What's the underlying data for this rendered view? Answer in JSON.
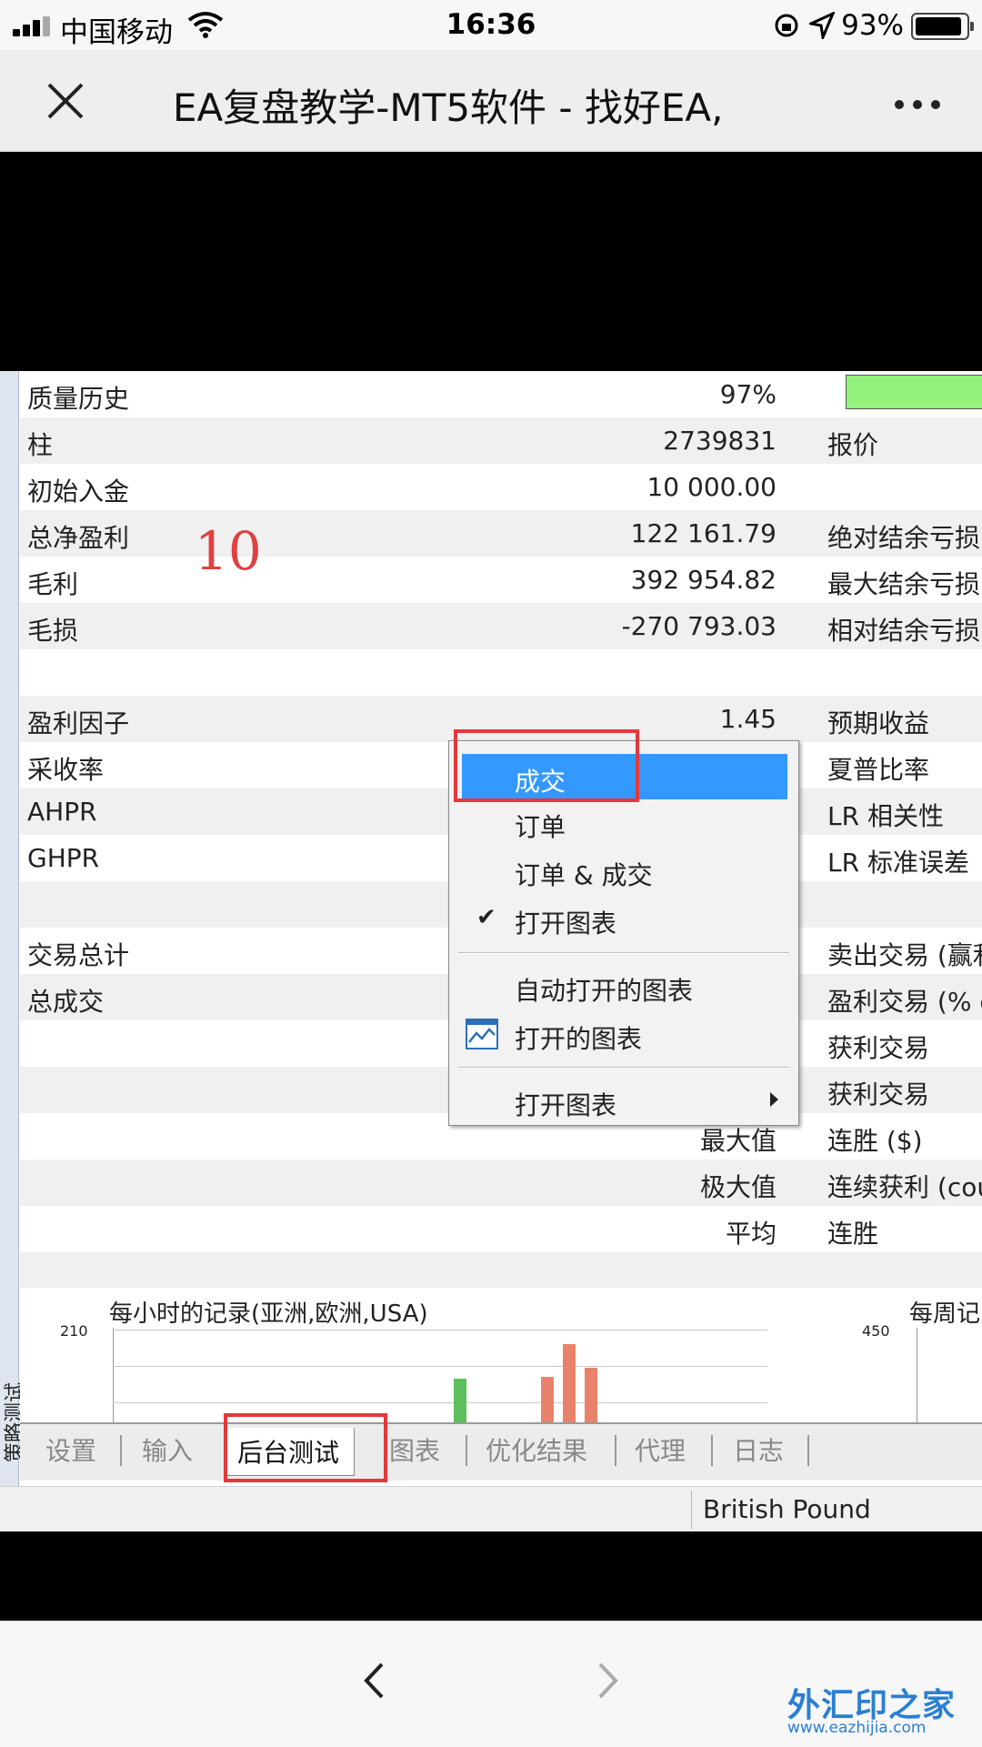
{
  "status_bar": {
    "carrier": "中国移动",
    "time": "16:36",
    "battery": "93%"
  },
  "nav": {
    "title": "EA复盘教学-MT5软件 - 找好EA,"
  },
  "side_label": "策略测试",
  "rows": [
    {
      "label": "质量历史",
      "value": "97%",
      "right": ""
    },
    {
      "label": "柱",
      "value": "2739831",
      "right": "报价"
    },
    {
      "label": "初始入金",
      "value": "10 000.00",
      "right": ""
    },
    {
      "label": "总净盈利",
      "value": "122 161.79",
      "right": "绝对结余亏损"
    },
    {
      "label": "毛利",
      "value": "392 954.82",
      "right": "最大结余亏损"
    },
    {
      "label": "毛损",
      "value": "-270 793.03",
      "right": "相对结余亏损"
    },
    {
      "label": "",
      "value": "",
      "right": ""
    },
    {
      "label": "盈利因子",
      "value": "1.45",
      "right": "预期收益"
    },
    {
      "label": "采收率",
      "value": "",
      "right": "夏普比率"
    },
    {
      "label": "AHPR",
      "value": "",
      "right": "LR 相关性"
    },
    {
      "label": "GHPR",
      "value": "",
      "right": "LR 标准误差"
    },
    {
      "label": "",
      "value": "",
      "right": ""
    },
    {
      "label": "交易总计",
      "value": "",
      "right": "卖出交易 (赢利"
    },
    {
      "label": "总成交",
      "value": "",
      "right": "盈利交易 (% of"
    },
    {
      "label": "",
      "value": "",
      "right": "获利交易"
    },
    {
      "label": "",
      "value": "",
      "right": "获利交易"
    },
    {
      "label": "",
      "value": "最大值",
      "right": "连胜 ($)"
    },
    {
      "label": "",
      "value": "极大值",
      "right": "连续获利 (cou"
    },
    {
      "label": "",
      "value": "平均",
      "right": "连胜"
    },
    {
      "label": "",
      "value": "",
      "right": ""
    }
  ],
  "annotation": "10",
  "context_menu": {
    "items": [
      "成交",
      "订单",
      "订单 & 成交",
      "打开图表",
      "自动打开的图表",
      "打开的图表",
      "打开图表"
    ],
    "checked": "打开图表"
  },
  "charts": {
    "hourly_title": "每小时的记录(亚洲,欧洲,USA)",
    "hourly_ytick": "210",
    "weekly_title": "每周记",
    "weekly_ytick": "450",
    "colors": {
      "green": "#5cbf5c",
      "orange": "#e8826a"
    }
  },
  "tabs": [
    "设置",
    "输入",
    "后台测试",
    "图表",
    "优化结果",
    "代理",
    "日志"
  ],
  "active_tab": "后台测试",
  "currency": "British Pound",
  "watermark": {
    "name": "外汇印之家",
    "url": "www.eazhijia.com"
  },
  "accent_colors": {
    "highlight": "#3399ff",
    "annotation_red": "#e5383b",
    "quality_green": "#92f27b"
  }
}
